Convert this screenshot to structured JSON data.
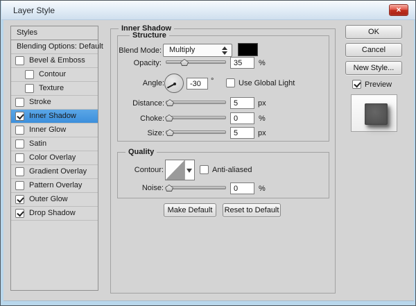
{
  "window": {
    "title": "Layer Style",
    "close_glyph": "×"
  },
  "sidebar": {
    "header": "Styles",
    "items": [
      {
        "label": "Blending Options: Default",
        "checkbox": false,
        "checked": false,
        "indent": false,
        "selected": false
      },
      {
        "label": "Bevel & Emboss",
        "checkbox": true,
        "checked": false,
        "indent": false,
        "selected": false
      },
      {
        "label": "Contour",
        "checkbox": true,
        "checked": false,
        "indent": true,
        "selected": false
      },
      {
        "label": "Texture",
        "checkbox": true,
        "checked": false,
        "indent": true,
        "selected": false
      },
      {
        "label": "Stroke",
        "checkbox": true,
        "checked": false,
        "indent": false,
        "selected": false
      },
      {
        "label": "Inner Shadow",
        "checkbox": true,
        "checked": true,
        "indent": false,
        "selected": true
      },
      {
        "label": "Inner Glow",
        "checkbox": true,
        "checked": false,
        "indent": false,
        "selected": false
      },
      {
        "label": "Satin",
        "checkbox": true,
        "checked": false,
        "indent": false,
        "selected": false
      },
      {
        "label": "Color Overlay",
        "checkbox": true,
        "checked": false,
        "indent": false,
        "selected": false
      },
      {
        "label": "Gradient Overlay",
        "checkbox": true,
        "checked": false,
        "indent": false,
        "selected": false
      },
      {
        "label": "Pattern Overlay",
        "checkbox": true,
        "checked": false,
        "indent": false,
        "selected": false
      },
      {
        "label": "Outer Glow",
        "checkbox": true,
        "checked": true,
        "indent": false,
        "selected": false
      },
      {
        "label": "Drop Shadow",
        "checkbox": true,
        "checked": true,
        "indent": false,
        "selected": false
      }
    ]
  },
  "panel": {
    "legend": "Inner Shadow",
    "structure": {
      "legend": "Structure",
      "blend_mode": {
        "label": "Blend Mode:",
        "value": "Multiply",
        "swatch_color": "#000000"
      },
      "opacity": {
        "label": "Opacity:",
        "value": "35",
        "unit": "%"
      },
      "angle": {
        "label": "Angle:",
        "value": "-30",
        "unit": "°",
        "global_light_label": "Use Global Light",
        "global_light_checked": false
      },
      "distance": {
        "label": "Distance:",
        "value": "5",
        "unit": "px"
      },
      "choke": {
        "label": "Choke:",
        "value": "0",
        "unit": "%"
      },
      "size": {
        "label": "Size:",
        "value": "5",
        "unit": "px"
      }
    },
    "quality": {
      "legend": "Quality",
      "contour_label": "Contour:",
      "anti_aliased_label": "Anti-aliased",
      "anti_aliased_checked": false,
      "noise": {
        "label": "Noise:",
        "value": "0",
        "unit": "%"
      }
    },
    "footer_buttons": {
      "make_default": "Make Default",
      "reset_to_default": "Reset to Default"
    }
  },
  "actions": {
    "ok": "OK",
    "cancel": "Cancel",
    "new_style": "New Style...",
    "preview_label": "Preview",
    "preview_checked": true
  },
  "colors": {
    "dialog_bg": "#d4d4d4",
    "selection_blue": "#3c8fdc",
    "frame_blue": "#b9d7ec",
    "close_red": "#c0301f",
    "blend_swatch": "#000000",
    "preview_square": "#575757"
  }
}
